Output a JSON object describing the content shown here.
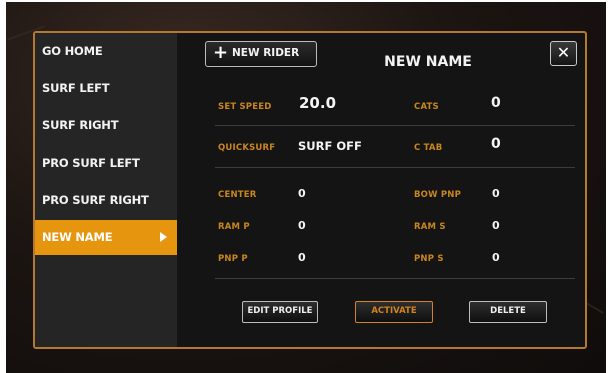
{
  "sidebar": {
    "items": [
      {
        "label": "GO HOME"
      },
      {
        "label": "SURF LEFT"
      },
      {
        "label": "SURF RIGHT"
      },
      {
        "label": "PRO SURF LEFT"
      },
      {
        "label": "PRO SURF RIGHT"
      },
      {
        "label": "NEW NAME",
        "active": true
      }
    ]
  },
  "header": {
    "new_rider_label": "NEW RIDER",
    "rider_name": "NEW NAME",
    "close_label": "✕"
  },
  "settings": {
    "set_speed": {
      "label": "SET SPEED",
      "value": "20.0"
    },
    "cats": {
      "label": "CATS",
      "value": "0"
    },
    "quicksurf": {
      "label": "QUICKSURF",
      "value": "SURF OFF"
    },
    "ctab": {
      "label": "C TAB",
      "value": "0"
    },
    "center": {
      "label": "CENTER",
      "value": "0"
    },
    "bow_pnp": {
      "label": "BOW PNP",
      "value": "0"
    },
    "ram_p": {
      "label": "RAM P",
      "value": "0"
    },
    "ram_s": {
      "label": "RAM S",
      "value": "0"
    },
    "pnp_p": {
      "label": "PNP P",
      "value": "0"
    },
    "pnp_s": {
      "label": "PNP S",
      "value": "0"
    }
  },
  "actions": {
    "edit_profile": "EDIT PROFILE",
    "activate": "ACTIVATE",
    "delete": "DELETE"
  },
  "colors": {
    "accent": "#e6950f",
    "label_orange": "#c9861f",
    "dialog_border": "#b5782f"
  }
}
